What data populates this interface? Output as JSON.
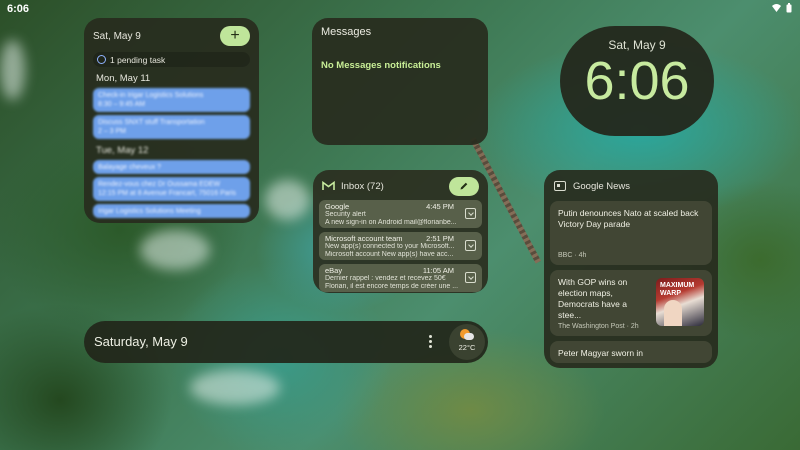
{
  "status_bar": {
    "time": "6:06"
  },
  "calendar": {
    "date_header": "Sat, May 9",
    "add_label": "+",
    "pending": "1 pending task",
    "days": [
      {
        "label": "Mon, May 11",
        "events": [
          {
            "title": "Check-in Irigar Logistics Solutions",
            "time": "8:30 – 9:45 AM"
          },
          {
            "title": "Discuss SNXT stuff Transportation",
            "time": "2 – 3 PM"
          }
        ]
      },
      {
        "label": "Tue, May 12",
        "events": [
          {
            "title": "Balayage cheveux ?",
            "time": ""
          },
          {
            "title": "Rendez-vous chez Dr Oussama EDEW",
            "time": "12:15 PM at 8 Avenue Francart, 75016 Paris"
          },
          {
            "title": "Irigar Logistics Solutions Meeting",
            "time": ""
          }
        ]
      }
    ]
  },
  "messages": {
    "title": "Messages",
    "empty": "No Messages notifications"
  },
  "clock": {
    "date": "Sat, May 9",
    "time": "6:06"
  },
  "gmail": {
    "title": "Inbox (72)",
    "mails": [
      {
        "sender": "Google",
        "time": "4:45 PM",
        "line1": "Security alert",
        "line2": "A new sign-in on Android mail@florianbe..."
      },
      {
        "sender": "Microsoft account team",
        "time": "2:51 PM",
        "line1": "New app(s) connected to your Microsoft...",
        "line2": "Microsoft account New app(s) have acc..."
      },
      {
        "sender": "eBay",
        "time": "11:05 AM",
        "line1": "Dernier rappel : vendez et recevez 50€",
        "line2": "Florian, il est encore temps de créer une ..."
      }
    ]
  },
  "news": {
    "title": "Google News",
    "articles": [
      {
        "headline": "Putin denounces Nato at scaled back Victory Day parade",
        "source": "BBC · 4h"
      },
      {
        "headline": "With GOP wins on election maps, Democrats have a stee...",
        "source": "The Washington Post · 2h",
        "thumb_text": "MAXIMUM WARP"
      },
      {
        "headline": "Peter Magyar sworn in",
        "source": ""
      }
    ]
  },
  "bottom_bar": {
    "date": "Saturday, May 9",
    "temperature": "22°C"
  },
  "colors": {
    "accent": "#bfe59a",
    "clock_digits": "#c7ea9f",
    "event": "#6ea0ea"
  }
}
